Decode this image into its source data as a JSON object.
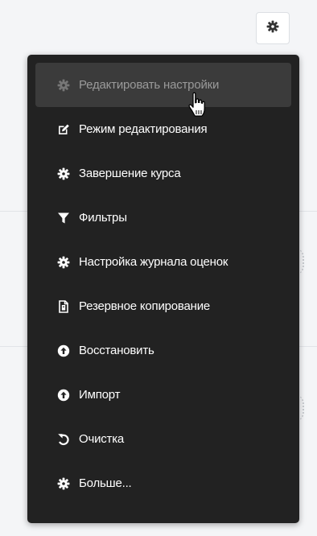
{
  "colors": {
    "menu_bg": "#222222",
    "active_bg": "#3b3b3b",
    "active_text": "#9a9a9a",
    "text": "#ffffff",
    "icon_dark": "#333333"
  },
  "header": {
    "settings_button_icon": "gear-icon"
  },
  "menu": {
    "items": [
      {
        "label": "Редактировать настройки",
        "icon": "gear-icon",
        "active": true
      },
      {
        "label": "Режим редактирования",
        "icon": "edit-icon"
      },
      {
        "label": "Завершение курса",
        "icon": "gear-icon"
      },
      {
        "label": "Фильтры",
        "icon": "filter-icon"
      },
      {
        "label": "Настройка журнала оценок",
        "icon": "gear-icon"
      },
      {
        "label": "Резервное копирование",
        "icon": "backup-file-icon"
      },
      {
        "label": "Восстановить",
        "icon": "upload-circle-icon"
      },
      {
        "label": "Импорт",
        "icon": "upload-circle-icon"
      },
      {
        "label": "Очистка",
        "icon": "undo-icon"
      },
      {
        "label": "Больше...",
        "icon": "gear-icon"
      }
    ]
  }
}
